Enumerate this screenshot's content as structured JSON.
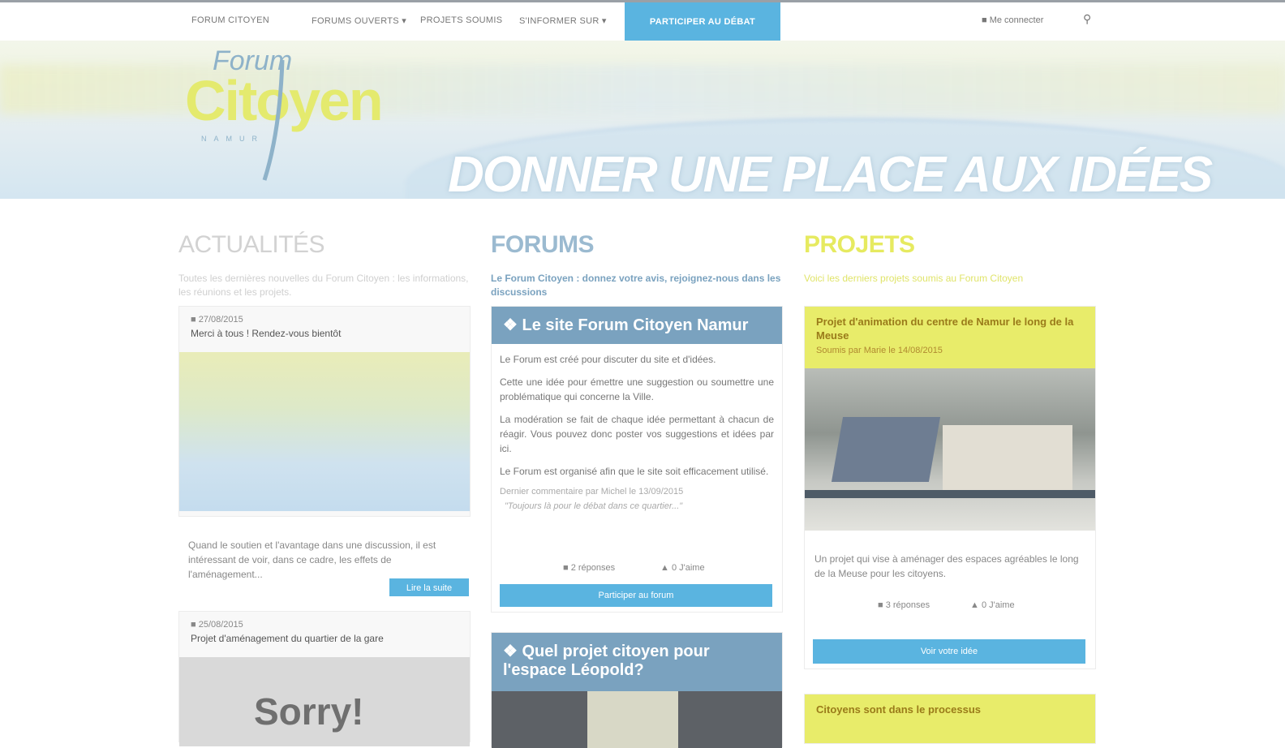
{
  "nav": {
    "items": [
      "FORUM CITOYEN",
      "FORUMS OUVERTS ▾",
      "PROJETS SOUMIS",
      "S'INFORMER SUR ▾"
    ],
    "cta": "PARTICIPER AU DÉBAT",
    "login": "Me connecter",
    "search_icon": "search-icon"
  },
  "banner": {
    "logo_top": "Forum",
    "logo_main": "Citoyen",
    "logo_sub": "NAMUR",
    "slogan": "DONNER UNE PLACE AUX IDÉES"
  },
  "colors": {
    "accent": "#5ab4e0",
    "forum": "#7aa2bf",
    "projets": "#e8ec6a",
    "projets_title": "#e6ea60"
  },
  "actualites": {
    "title": "ACTUALITÉS",
    "subtitle": "Toutes les dernières nouvelles du Forum Citoyen : les informations, les réunions et les projets.",
    "cards": [
      {
        "date": "27/08/2015",
        "title": "Merci à tous ! Rendez-vous bientôt",
        "text": "Quand le soutien et l'avantage dans une discussion, il est intéressant de voir, dans ce cadre, les effets de l'aménagement...",
        "button": "Lire la suite"
      },
      {
        "date": "25/08/2015",
        "title": "Projet d'aménagement du quartier de la gare",
        "image_text": "Sorry!"
      }
    ]
  },
  "forums": {
    "title": "FORUMS",
    "subtitle": "Le Forum Citoyen : donnez votre avis, rejoignez-nous dans les discussions",
    "cards": [
      {
        "title": "Le site Forum Citoyen Namur",
        "paragraphs": [
          "Le Forum est créé pour discuter du site et d'idées.",
          "Cette une idée pour émettre une suggestion ou soumettre une problématique qui concerne la Ville.",
          "La modération se fait de chaque idée permettant à chacun de réagir. Vous pouvez donc poster vos suggestions et idées par ici.",
          "Le Forum est organisé afin que le site soit efficacement utilisé."
        ],
        "last_comment": "Dernier commentaire par Michel le 13/09/2015",
        "quote": "\"Toujours là pour le débat dans ce quartier...\"",
        "comments": "2 réponses",
        "likes": "0 J'aime",
        "button": "Participer au forum"
      },
      {
        "title": "Quel projet citoyen pour l'espace Léopold?"
      }
    ]
  },
  "projets": {
    "title": "PROJETS",
    "subtitle": "Voici les derniers projets soumis au Forum Citoyen",
    "cards": [
      {
        "title": "Projet d'animation du centre de Namur le long de la Meuse",
        "meta": "Soumis par Marie le 14/08/2015",
        "text": "Un projet qui vise à aménager des espaces agréables le long de la Meuse pour les citoyens.",
        "comments": "3 réponses",
        "likes": "0 J'aime",
        "button": "Voir votre idée"
      },
      {
        "title": "Citoyens sont dans le processus"
      }
    ]
  }
}
